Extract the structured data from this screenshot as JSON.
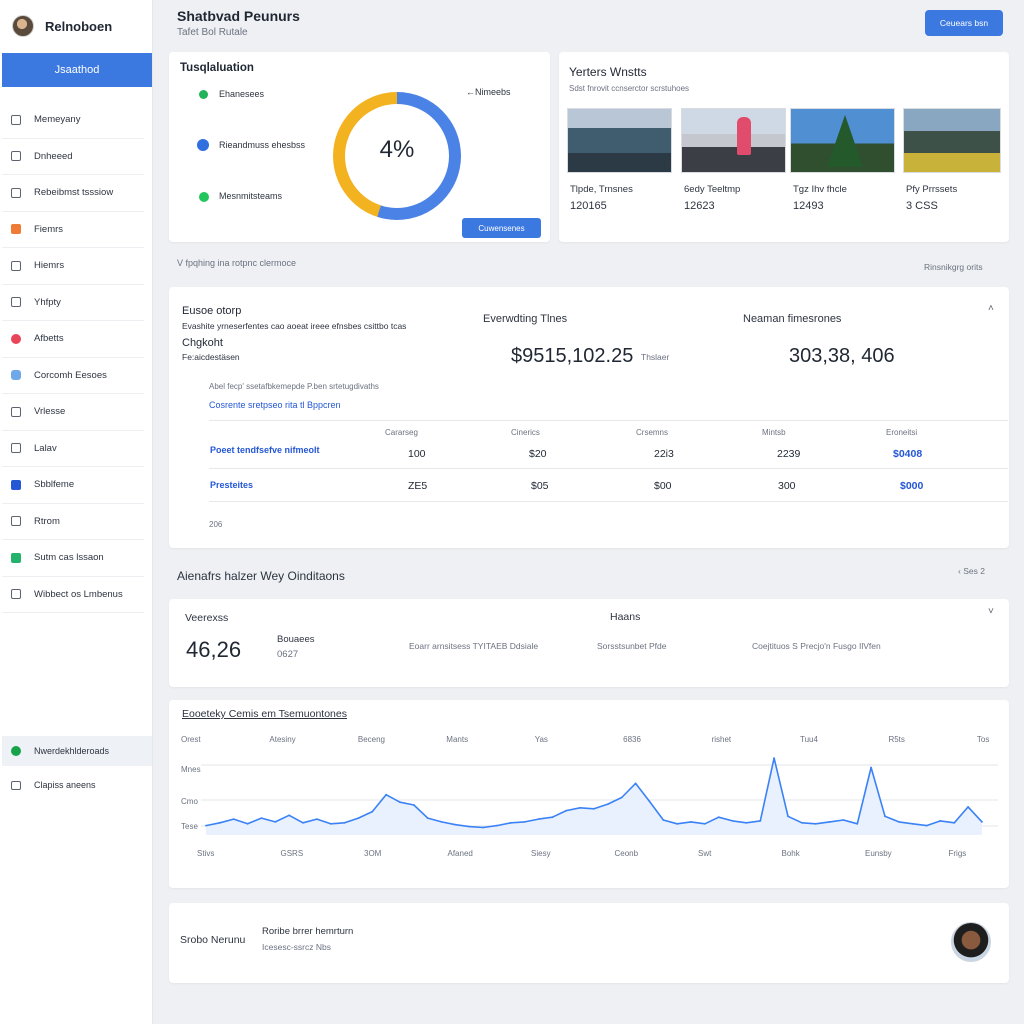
{
  "sidebar": {
    "profile_name": "Relnoboen",
    "active_item": "Jsaathod",
    "items": [
      {
        "label": "Memeyany",
        "icon": "document-icon"
      },
      {
        "label": "Dnheeed",
        "icon": "monitor-icon"
      },
      {
        "label": "Rebeibmst tsssiow",
        "icon": "window-icon"
      },
      {
        "label": "Fiemrs",
        "icon": "orange-app-icon"
      },
      {
        "label": "Hiemrs",
        "icon": "phone-icon"
      },
      {
        "label": "Yhfpty",
        "icon": "edit-icon"
      },
      {
        "label": "Afbetts",
        "icon": "red-circle-icon"
      },
      {
        "label": "Corcomh  Eesoes",
        "icon": "cloud-icon"
      },
      {
        "label": "Vrlesse",
        "icon": "window-icon"
      },
      {
        "label": "Lalav",
        "icon": "tablet-icon"
      },
      {
        "label": "Sbblfeme",
        "icon": "blue-app-icon"
      },
      {
        "label": "Rtrom",
        "icon": "screen-icon"
      },
      {
        "label": "Sutm cas lssaon",
        "icon": "green-app-icon"
      },
      {
        "label": "Wibbect os Lmbenus",
        "icon": "settings-icon"
      }
    ],
    "bottom_items": [
      {
        "label": "Nwerdekhlderoads"
      },
      {
        "label": "Clapiss aneens"
      }
    ]
  },
  "header": {
    "title": "Shatbvad Peunurs",
    "subtitle": "Tafet Bol Rutale",
    "button_label": "Ceuears bsn"
  },
  "donut_card": {
    "title": "Tusqlaluation",
    "legend": [
      {
        "label": "Ehanesees",
        "color": "#22b35b"
      },
      {
        "label": "Rieandmuss ehesbss",
        "color": "#2f6fe0"
      },
      {
        "label": "Mesnmitsteams",
        "color": "#22c55e"
      }
    ],
    "pointer_label": "Nimeebs",
    "value": "4%",
    "filled_percent": 55,
    "button_label": "Cuwensenes"
  },
  "gallery_card": {
    "title": "Yerters Wnstts",
    "subtitle": "Sdst fnrovit ccnserctor scrstuhoes",
    "items": [
      {
        "title": "Tlpde, Trnsnes",
        "value": "120165"
      },
      {
        "title": "6edy Teeltmp",
        "value": "12623"
      },
      {
        "title": "Tgz Ihv fhcle",
        "value": "12493"
      },
      {
        "title": "Pfy Prrssets",
        "value": "3 CSS"
      }
    ]
  },
  "section1": {
    "left_label": "V fpqhing ina rotpnc clermoce",
    "right_label": "Rinsnikgrg orits"
  },
  "summary_card": {
    "title": "Eusoe otorp",
    "desc": "Evashite yrneserfentes cao aoeat ireee efnsbes csittbo tcas",
    "sub_title": "Chgkoht",
    "sub_desc": "Fe:aicdestäsen",
    "metric1_label": "Everwdting Tlnes",
    "metric1_value": "$9515,102.25",
    "metric1_unit": "Thslaer",
    "metric2_label": "Neaman fimesrones",
    "metric2_value": "303,38, 406",
    "note": "Abel fecp' ssetafbkemepde P.ben srtetugdivaths",
    "link": "Cosrente sretpseo rita tl Bppcren",
    "columns": [
      "Cararseg",
      "Cinerics",
      "Crsemns",
      "Mintsb",
      "Eroneitsi"
    ],
    "rows": [
      {
        "label": "Poeet tendfsefve nifmeolt",
        "cells": [
          "100",
          "$20",
          "22i3",
          "2239",
          "$0408"
        ]
      },
      {
        "label": "Presteites",
        "cells": [
          "ZE5",
          "$05",
          "$00",
          "300",
          "$000"
        ]
      }
    ],
    "footer_label": "206"
  },
  "section2": {
    "title": "Aienafrs halzer Wey Oinditaons",
    "right_label": "Ses 2"
  },
  "kpi_card": {
    "title": "Veerexss",
    "value": "46,26",
    "sub_title": "Bouaees",
    "sub_value": "0627",
    "center_title": "Haans",
    "c1": "Eoarr arnsitsess TYITAEB Ddsiale",
    "c2": "Sorsstsunbet Pfde",
    "c3": "Coejtituos S Precjo'n Fusgo IlVfen"
  },
  "line_card": {
    "title": "Eooeteky Cemis em Tsemuontones",
    "top_labels": [
      "Orest",
      "Atesiny",
      "Beceng",
      "Mants",
      "Yas",
      "6836",
      "rishet",
      "Tuu4",
      "R5ts",
      "Tos"
    ],
    "y_labels": [
      "Mnes",
      "Cmo",
      "Tese"
    ],
    "bottom_labels": [
      "Stivs",
      "GSRS",
      "3OM",
      "Afaned",
      "Siesy",
      "Ceonb",
      "Swt",
      "Bohk",
      "Eunsby",
      "Frigs"
    ]
  },
  "chart_data": {
    "type": "line",
    "title": "Eooeteky Cemis em Tsemuontones",
    "categories": [
      "Stivs",
      "GSRS",
      "3OM",
      "Afaned",
      "Siesy",
      "Ceonb",
      "Swt",
      "Bohk",
      "Eunsby",
      "Frigs"
    ],
    "series": [
      {
        "values": [
          10,
          13,
          17,
          12,
          18,
          14,
          21,
          13,
          17,
          12,
          13,
          18,
          25,
          43,
          35,
          32,
          18,
          14,
          11,
          9,
          8,
          10,
          13,
          14,
          17,
          19,
          26,
          29,
          28,
          33,
          40,
          55,
          36,
          16,
          12,
          14,
          12,
          19,
          15,
          13,
          15,
          82,
          20,
          13,
          12,
          14,
          16,
          12,
          72,
          20,
          14,
          12,
          10,
          15,
          13,
          30,
          14
        ]
      }
    ],
    "ylim": [
      0,
      100
    ],
    "grid": true,
    "line_color": "#3b82f6"
  },
  "footer_card": {
    "label": "Srobo Nerunu",
    "title": "Roribe brrer hemrturn",
    "sub": "Icesesc-ssrcz Nbs"
  }
}
